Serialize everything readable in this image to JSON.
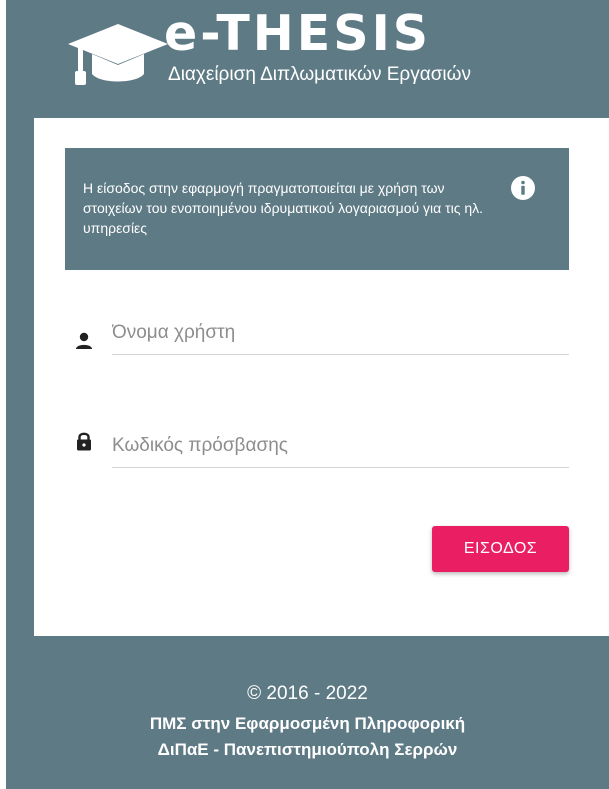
{
  "header": {
    "logo_icon": "graduation-cap-icon",
    "title": "e-THESIS",
    "subtitle": "Διαχείριση Διπλωματικών Εργασιών"
  },
  "login": {
    "info_text": "Η είσοδος στην εφαρμογή πραγματοποιείται με χρήση των στοιχείων του ενοποιημένου ιδρυματικού λογαριασμού για τις ηλ. υπηρεσίες",
    "info_icon": "info-icon",
    "username": {
      "icon": "user-icon",
      "placeholder": "Όνομα χρήστη",
      "value": ""
    },
    "password": {
      "icon": "lock-icon",
      "placeholder": "Κωδικός πρόσβασης",
      "value": ""
    },
    "submit_label": "ΕΙΣΟΔΟΣ"
  },
  "footer": {
    "copyright": "© 2016 - 2022",
    "program": "ΠΜΣ στην Εφαρμοσμένη Πληροφορική",
    "institution": "ΔιΠαΕ - Πανεπιστημιούπολη Σερρών"
  },
  "colors": {
    "background": "#5e7a85",
    "card": "#ffffff",
    "accent": "#e91e63"
  }
}
